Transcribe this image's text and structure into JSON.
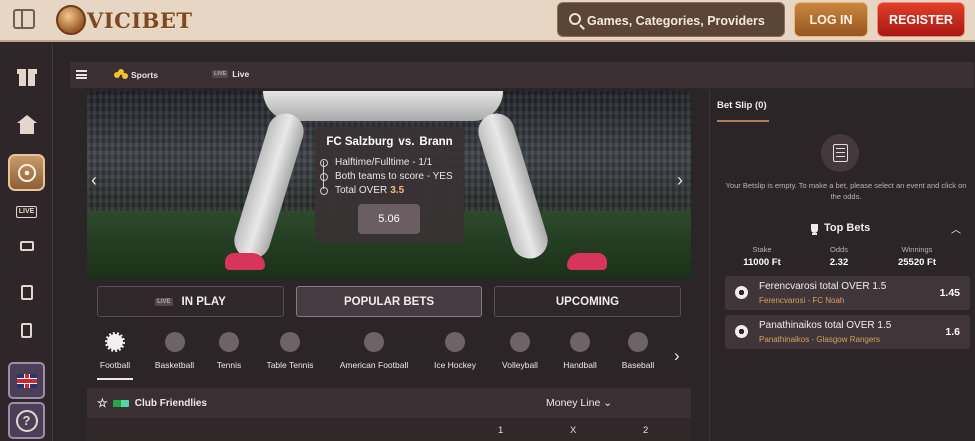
{
  "header": {
    "logo_text": "VICIBET",
    "search_placeholder": "Games, Categories, Providers",
    "login_label": "LOG IN",
    "register_label": "REGISTER"
  },
  "sidebar": {
    "items": [
      {
        "icon": "gift-icon"
      },
      {
        "icon": "home-icon"
      },
      {
        "icon": "sports-ball-icon",
        "active": true
      },
      {
        "icon": "live-icon",
        "label": "LIVE"
      },
      {
        "icon": "casino-icon"
      },
      {
        "icon": "slot-machine-icon"
      },
      {
        "icon": "cards-icon"
      },
      {
        "icon": "uk-flag-icon"
      },
      {
        "icon": "help-icon",
        "label": "?"
      }
    ]
  },
  "subnav": {
    "sports_label": "Sports",
    "live_badge": "LIVE",
    "live_label": "Live"
  },
  "banner": {
    "home_team": "FC Salzburg",
    "vs": "vs.",
    "away_team": "Brann",
    "bets": [
      {
        "text": "Halftime/Fulltime - 1/1",
        "highlight": ""
      },
      {
        "text": "Both teams to score - YES",
        "highlight": ""
      },
      {
        "text": "Total OVER",
        "highlight": "3.5"
      }
    ],
    "odds": "5.06"
  },
  "tabs": {
    "live_badge": "LIVE",
    "in_play": "IN PLAY",
    "popular": "POPULAR BETS",
    "upcoming": "UPCOMING"
  },
  "sports": [
    "Football",
    "Basketball",
    "Tennis",
    "Table Tennis",
    "American Football",
    "Ice Hockey",
    "Volleyball",
    "Handball",
    "Baseball"
  ],
  "league": {
    "name": "Club Friendlies",
    "market": "Money Line",
    "columns": [
      "1",
      "X",
      "2"
    ]
  },
  "betslip": {
    "title": "Bet Slip (0)",
    "empty_text": "Your Betslip is empty. To make a bet, please select an event and click on the odds.",
    "top_bets_title": "Top Bets",
    "stake_label": "Stake",
    "stake_value": "11000 Ft",
    "odds_label": "Odds",
    "odds_value": "2.32",
    "winnings_label": "Winnings",
    "winnings_value": "25520 Ft",
    "items": [
      {
        "event": "Ferencvarosi total OVER 1.5",
        "match": "Ferencvarosi - FC Noah",
        "odds": "1.45"
      },
      {
        "event": "Panathinaikos total OVER 1.5",
        "match": "Panathinaikos - Glasgow Rangers",
        "odds": "1.6"
      }
    ]
  },
  "colors": {
    "background": "#2b2528",
    "header": "#e8d6c4",
    "accent_gold": "#d9a15c",
    "register_red": "#d2291f"
  }
}
